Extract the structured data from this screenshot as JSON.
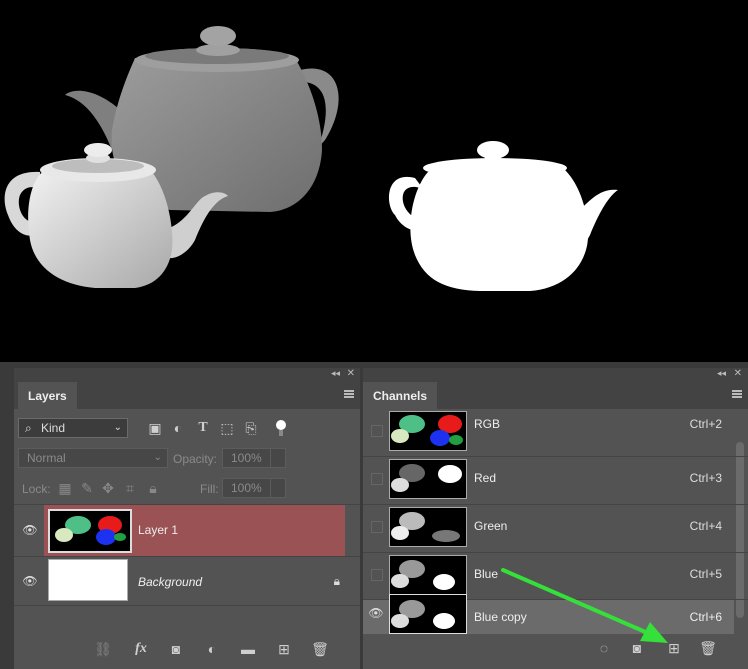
{
  "layers_panel": {
    "tab": "Layers",
    "filter_label": "Kind",
    "blend_mode": "Normal",
    "opacity_label": "Opacity:",
    "opacity_value": "100%",
    "lock_label": "Lock:",
    "fill_label": "Fill:",
    "fill_value": "100%",
    "layers": [
      {
        "name": "Layer 1",
        "selected": true,
        "visible": true
      },
      {
        "name": "Background",
        "selected": false,
        "visible": true,
        "locked": true
      }
    ]
  },
  "channels_panel": {
    "tab": "Channels",
    "channels": [
      {
        "name": "RGB",
        "shortcut": "Ctrl+2",
        "visible": false
      },
      {
        "name": "Red",
        "shortcut": "Ctrl+3",
        "visible": false
      },
      {
        "name": "Green",
        "shortcut": "Ctrl+4",
        "visible": false
      },
      {
        "name": "Blue",
        "shortcut": "Ctrl+5",
        "visible": false
      },
      {
        "name": "Blue copy",
        "shortcut": "Ctrl+6",
        "visible": true,
        "selected": true
      }
    ]
  },
  "colors": {
    "selected_layer": "#9a5254",
    "selected_channel": "#6b6b6b",
    "annotation_arrow": "#35e03a"
  }
}
